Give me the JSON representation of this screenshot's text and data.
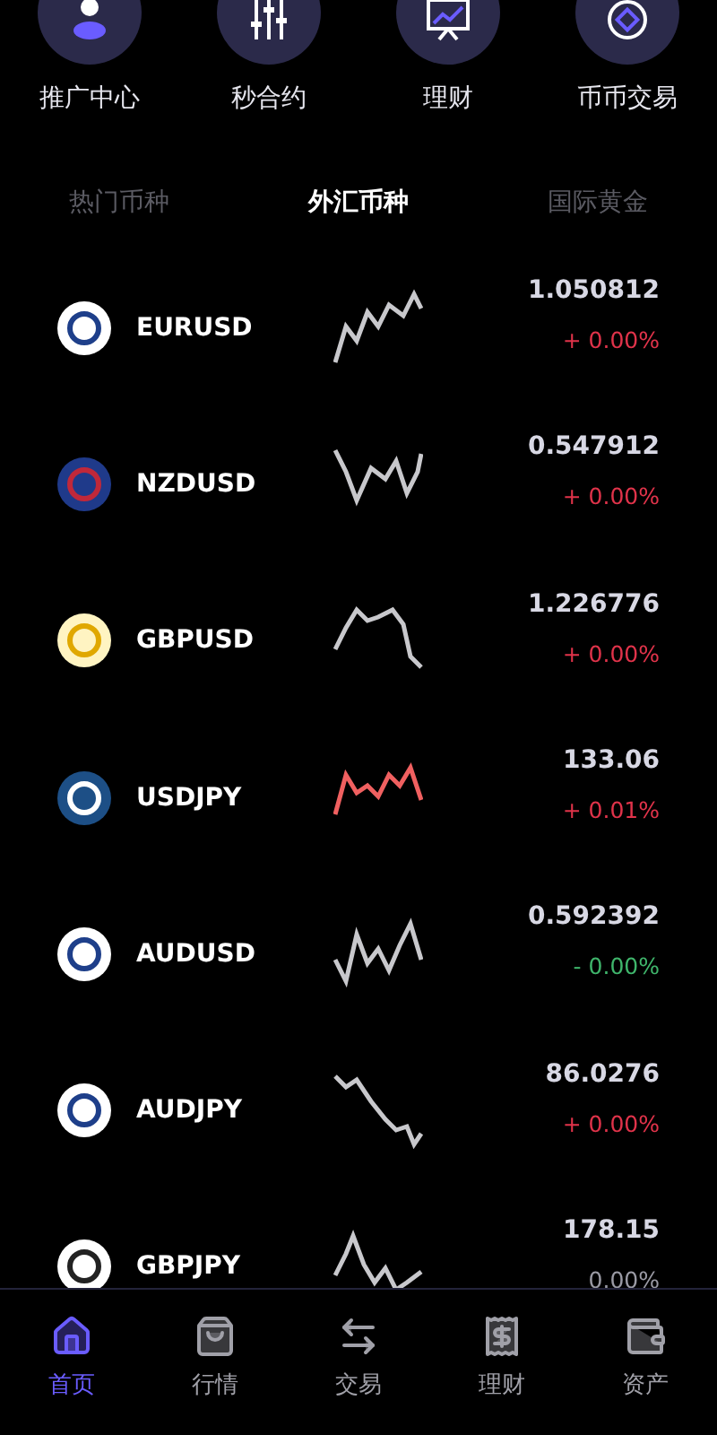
{
  "shortcuts": [
    {
      "kind": "person",
      "label": "推广中心"
    },
    {
      "kind": "sliders",
      "label": "秒合约"
    },
    {
      "kind": "chart",
      "label": "理财"
    },
    {
      "kind": "ring",
      "label": "币币交易"
    }
  ],
  "tabs": [
    {
      "label": "热门币种",
      "selected": false
    },
    {
      "label": "外汇币种",
      "selected": true
    },
    {
      "label": "国际黄金",
      "selected": false
    }
  ],
  "pairs": [
    {
      "kind": "euro",
      "symbol": "EURUSD",
      "color": "#c8c8cc",
      "price": "1.050812",
      "change": {
        "text": "+ 0.00%",
        "color": "#e0334a"
      }
    },
    {
      "kind": "flag",
      "symbol": "NZDUSD",
      "color": "#c8c8cc",
      "price": "0.547912",
      "change": {
        "text": "+ 0.00%",
        "color": "#e0334a"
      }
    },
    {
      "kind": "pound",
      "symbol": "GBPUSD",
      "color": "#c8c8cc",
      "price": "1.226776",
      "change": {
        "text": "+ 0.00%",
        "color": "#e0334a"
      }
    },
    {
      "kind": "globe",
      "symbol": "USDJPY",
      "color": "#f06060",
      "price": "133.06",
      "change": {
        "text": "+ 0.01%",
        "color": "#e0334a"
      }
    },
    {
      "kind": "dollar",
      "symbol": "AUDUSD",
      "color": "#c8c8cc",
      "price": "0.592392",
      "change": {
        "text": "- 0.00%",
        "color": "#3fb56b"
      }
    },
    {
      "kind": "dollar",
      "symbol": "AUDJPY",
      "color": "#c8c8cc",
      "price": "86.0276",
      "change": {
        "text": "+ 0.00%",
        "color": "#e0334a"
      }
    },
    {
      "kind": "exchange",
      "symbol": "GBPJPY",
      "color": "#c8c8cc",
      "price": "178.15",
      "change": {
        "text": "0.00%",
        "color": "#9a9aa4"
      }
    }
  ],
  "nav": [
    {
      "kind": "home",
      "label": "首页",
      "selected": true
    },
    {
      "kind": "bag",
      "label": "行情",
      "selected": false
    },
    {
      "kind": "swap",
      "label": "交易",
      "selected": false
    },
    {
      "kind": "receipt",
      "label": "理财",
      "selected": false
    },
    {
      "kind": "wallet",
      "label": "资产",
      "selected": false
    }
  ]
}
